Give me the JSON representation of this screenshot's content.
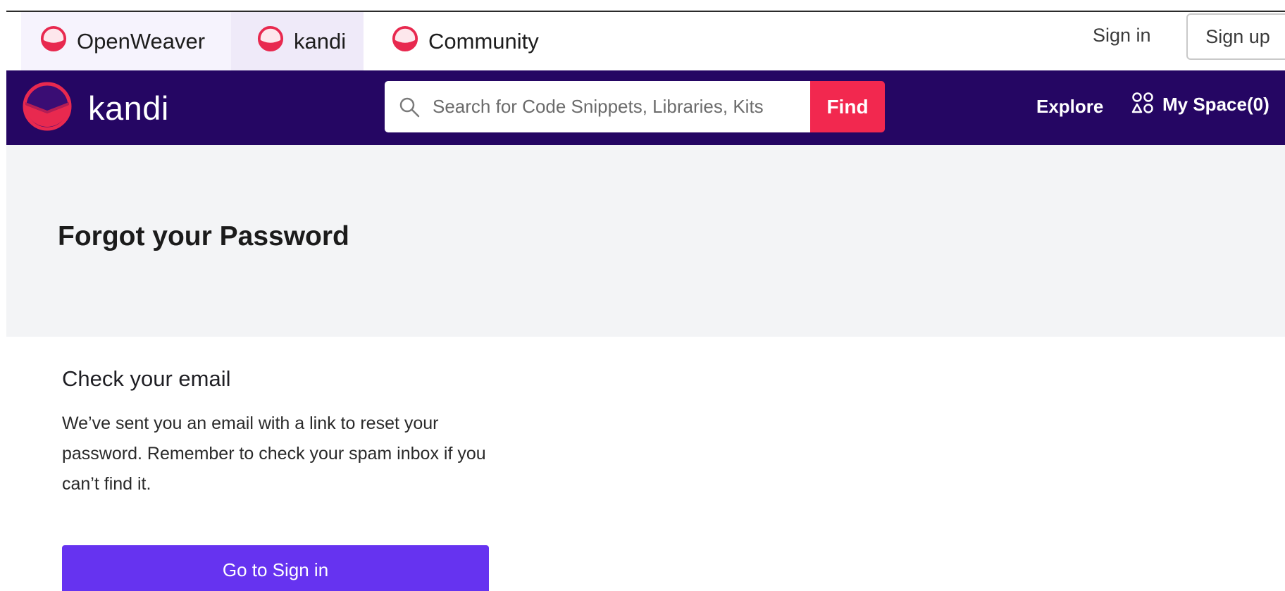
{
  "topbar": {
    "products": [
      {
        "label": "OpenWeaver",
        "icon": "openweaver-logo-icon"
      },
      {
        "label": "kandi",
        "icon": "kandi-logo-icon"
      },
      {
        "label": "Community",
        "icon": "community-logo-icon"
      }
    ],
    "sign_in": "Sign in",
    "sign_up": "Sign up"
  },
  "navbar": {
    "brand": "kandi",
    "search_placeholder": "Search for Code Snippets, Libraries, Kits",
    "find_label": "Find",
    "explore_label": "Explore",
    "myspace_label": "My Space(0)"
  },
  "main": {
    "page_title": "Forgot your Password",
    "heading": "Check your email",
    "body": "We’ve sent you an email with a link to reset your password. Remember to check your spam inbox if you can’t find it.",
    "button_label": "Go to Sign in"
  },
  "colors": {
    "navbar_bg": "#250663",
    "find_button": "#f2284f",
    "primary_button": "#6633f0",
    "logo_red": "#e8294f",
    "heading_band_bg": "#f3f4f6"
  }
}
